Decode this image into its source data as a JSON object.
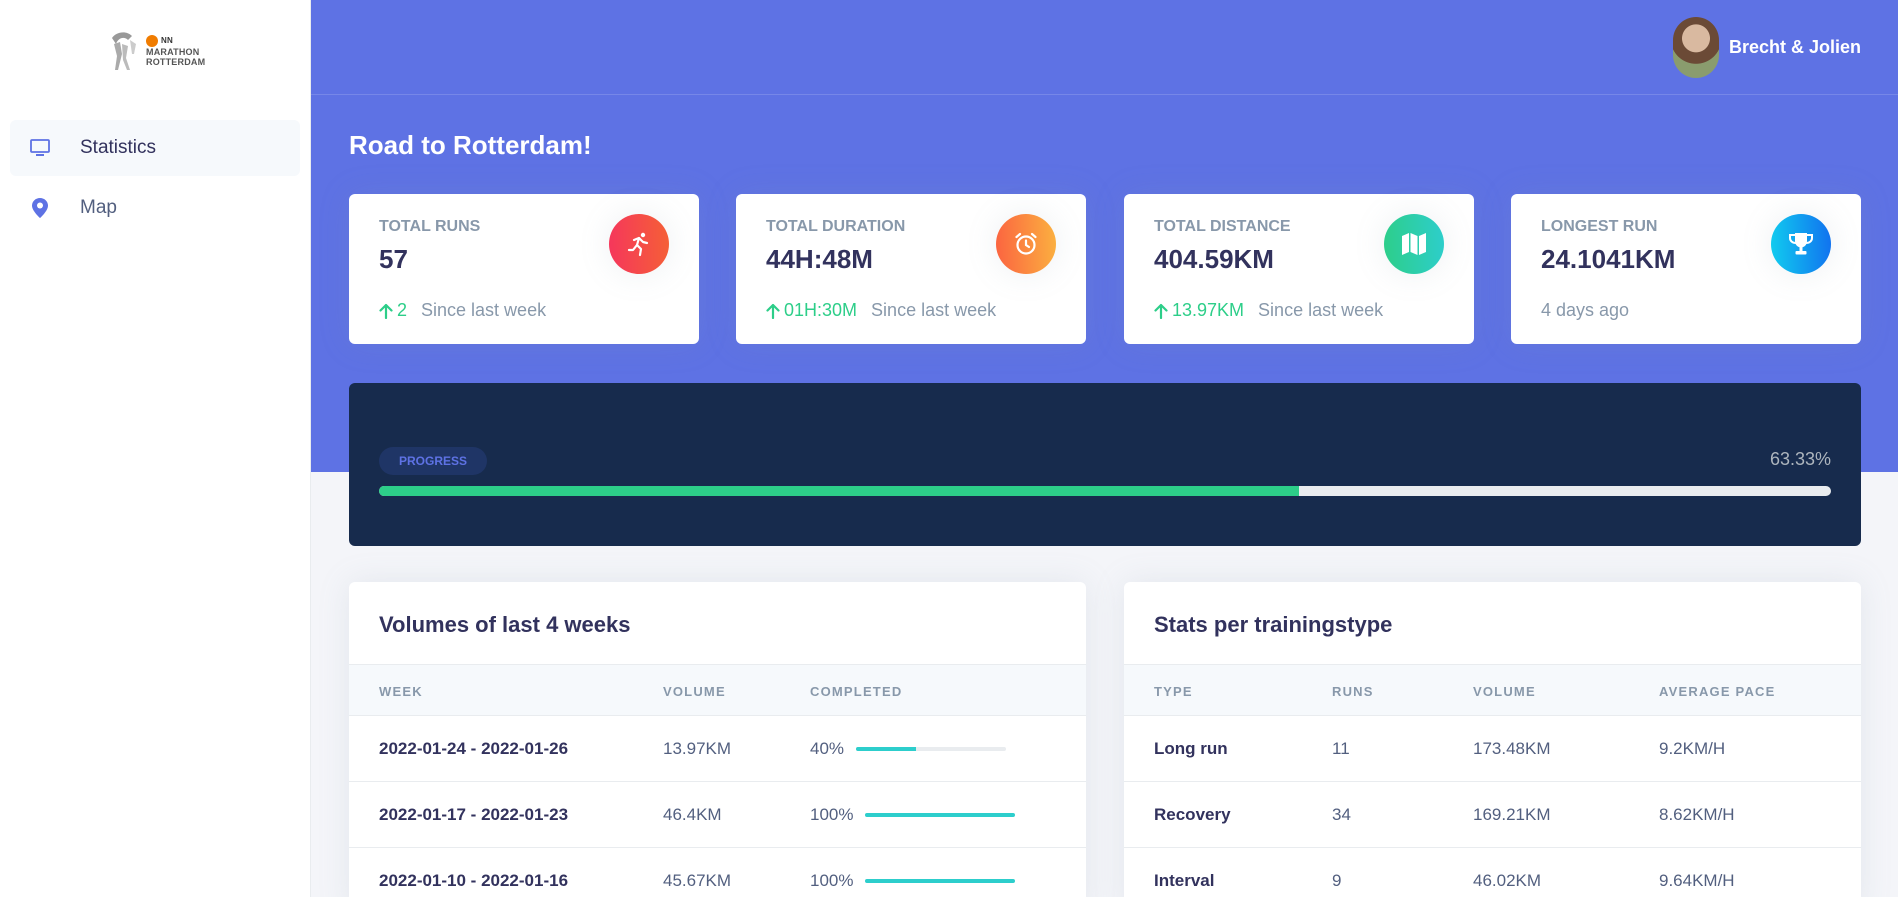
{
  "sidebar": {
    "logo": {
      "brand": "NN",
      "line1": "MARATHON",
      "line2": "ROTTERDAM"
    },
    "items": [
      {
        "label": "Statistics",
        "icon": "monitor-icon",
        "active": true
      },
      {
        "label": "Map",
        "icon": "map-pin-icon",
        "active": false
      }
    ]
  },
  "header": {
    "user_name": "Brecht & Jolien",
    "page_title": "Road to Rotterdam!"
  },
  "cards": [
    {
      "label": "Total runs",
      "value": "57",
      "delta": "2",
      "since": "Since last week",
      "icon": "running-icon",
      "color": "#f5365c"
    },
    {
      "label": "Total duration",
      "value": "44H:48M",
      "delta": "01H:30M",
      "since": "Since last week",
      "icon": "alarm-clock-icon",
      "color": "#fb6340"
    },
    {
      "label": "Total distance",
      "value": "404.59KM",
      "delta": "13.97KM",
      "since": "Since last week",
      "icon": "map-icon",
      "color": "#2dce89"
    },
    {
      "label": "Longest run",
      "value": "24.1041KM",
      "since": "4 days ago",
      "icon": "trophy-icon",
      "color": "#11cdef"
    }
  ],
  "progress": {
    "badge": "PROGRESS",
    "percent_label": "63.33%",
    "fraction": 0.6333
  },
  "volumes": {
    "title": "Volumes of last 4 weeks",
    "headers": [
      "Week",
      "Volume",
      "Completed"
    ],
    "rows": [
      {
        "week": "2022-01-24 - 2022-01-26",
        "volume": "13.97KM",
        "completed": "40%",
        "fraction": 0.4
      },
      {
        "week": "2022-01-17 - 2022-01-23",
        "volume": "46.4KM",
        "completed": "100%",
        "fraction": 1.0
      },
      {
        "week": "2022-01-10 - 2022-01-16",
        "volume": "45.67KM",
        "completed": "100%",
        "fraction": 1.0
      }
    ]
  },
  "training": {
    "title": "Stats per trainingstype",
    "headers": [
      "Type",
      "Runs",
      "Volume",
      "Average pace"
    ],
    "rows": [
      {
        "type": "Long run",
        "runs": "11",
        "volume": "173.48KM",
        "pace": "9.2KM/H"
      },
      {
        "type": "Recovery",
        "runs": "34",
        "volume": "169.21KM",
        "pace": "8.62KM/H"
      },
      {
        "type": "Interval",
        "runs": "9",
        "volume": "46.02KM",
        "pace": "9.64KM/H"
      }
    ]
  },
  "colors": {
    "primary": "#5e72e4",
    "dark": "#172b4d",
    "success": "#2dce89",
    "info": "#2dcecc"
  }
}
